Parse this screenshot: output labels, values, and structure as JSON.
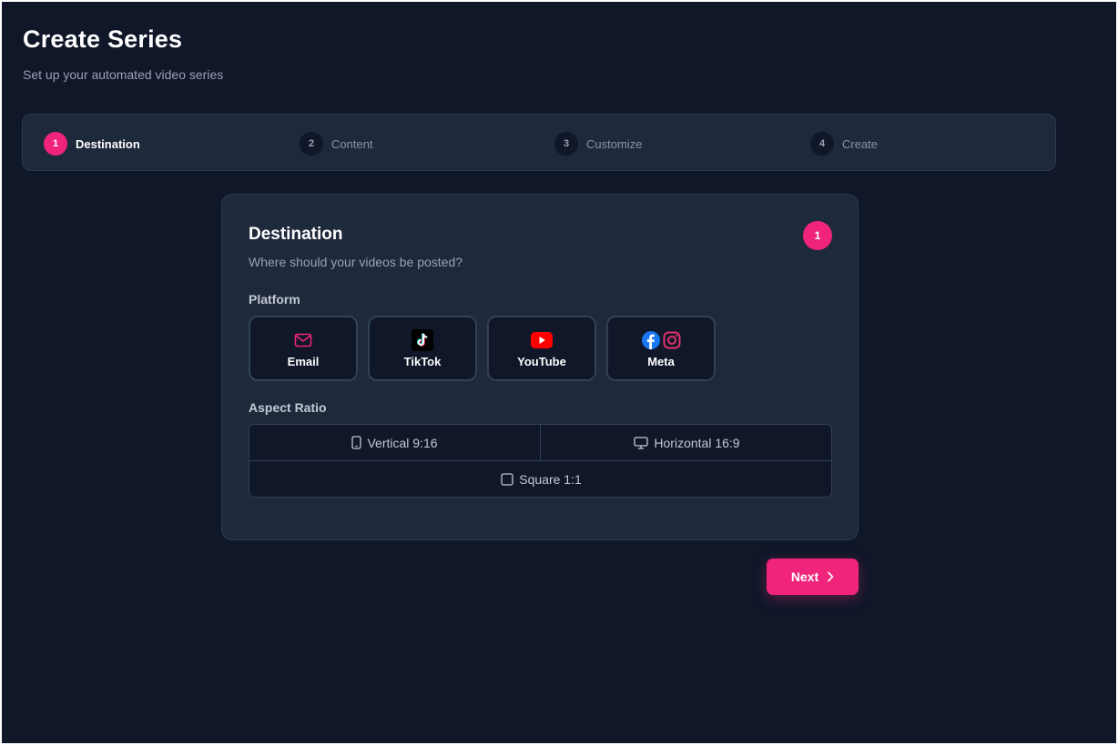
{
  "header": {
    "title": "Create Series",
    "subtitle": "Set up your automated video series"
  },
  "stepper": {
    "steps": [
      {
        "number": "1",
        "label": "Destination",
        "active": true
      },
      {
        "number": "2",
        "label": "Content",
        "active": false
      },
      {
        "number": "3",
        "label": "Customize",
        "active": false
      },
      {
        "number": "4",
        "label": "Create",
        "active": false
      }
    ]
  },
  "card": {
    "title": "Destination",
    "subtitle": "Where should your videos be posted?",
    "badge": "1",
    "platform_label": "Platform",
    "platforms": [
      {
        "label": "Email",
        "icon": "mail-icon"
      },
      {
        "label": "TikTok",
        "icon": "tiktok-icon"
      },
      {
        "label": "YouTube",
        "icon": "youtube-icon"
      },
      {
        "label": "Meta",
        "icon": "facebook-instagram-icon"
      }
    ],
    "aspect_label": "Aspect Ratio",
    "aspect_ratios": [
      {
        "label": "Vertical 9:16",
        "icon": "phone-icon"
      },
      {
        "label": "Horizontal 16:9",
        "icon": "monitor-icon"
      },
      {
        "label": "Square 1:1",
        "icon": "square-icon"
      }
    ]
  },
  "footer": {
    "next_label": "Next"
  },
  "colors": {
    "accent": "#f0247a",
    "background": "#0f1729",
    "surface": "#1e293b"
  }
}
